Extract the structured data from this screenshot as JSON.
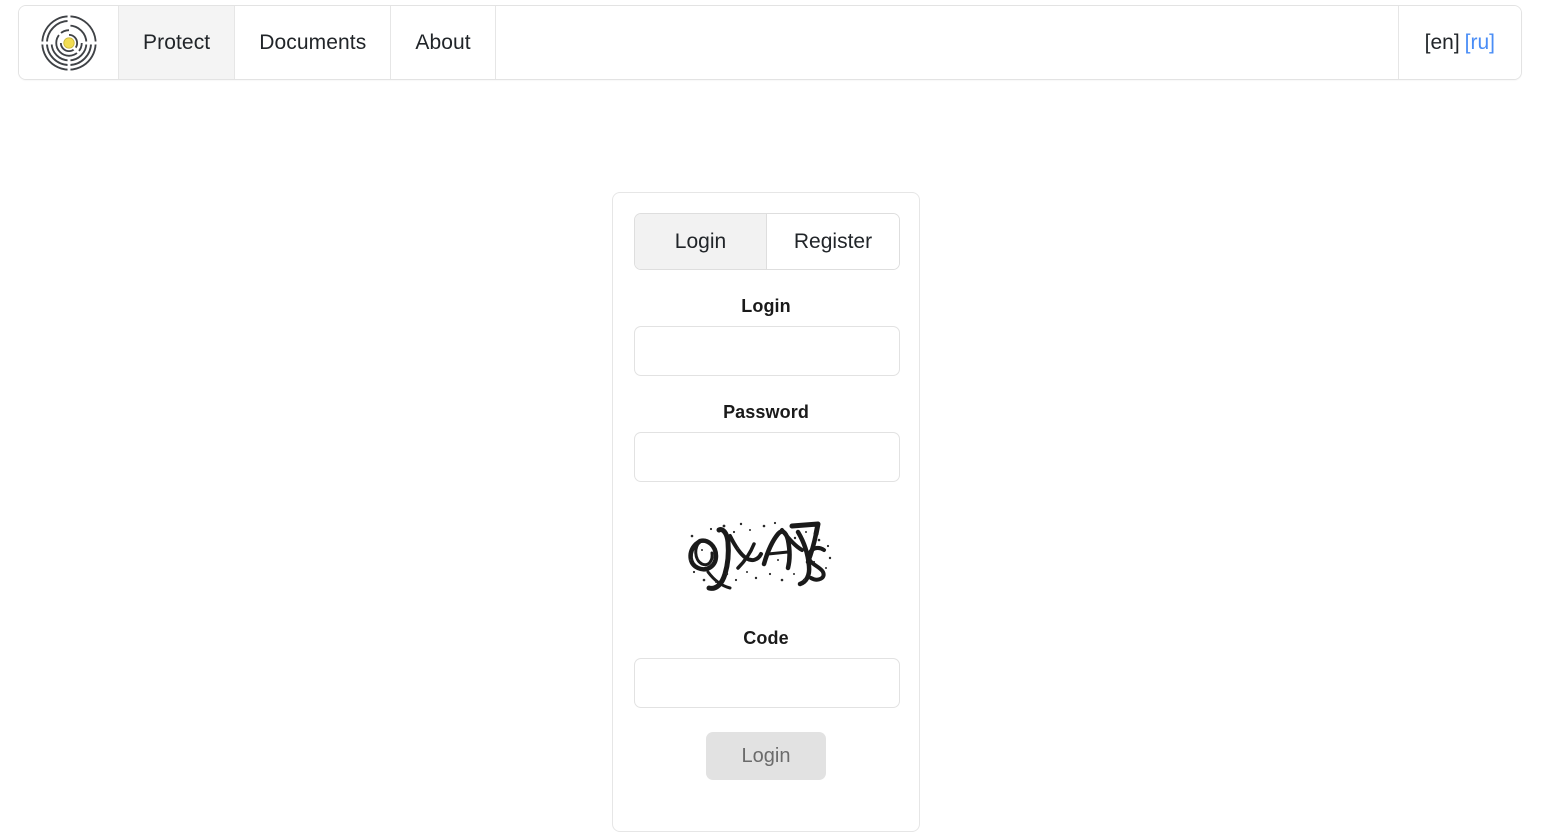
{
  "navbar": {
    "brand": {
      "icon": "labyrinth-logo-icon",
      "ring_color": "#3f4246",
      "center_color": "#f2dd52"
    },
    "items": [
      {
        "label": "Protect",
        "active": true
      },
      {
        "label": "Documents",
        "active": false
      },
      {
        "label": "About",
        "active": false
      }
    ],
    "language": {
      "current": "[en]",
      "alternate": "[ru]",
      "link_color": "#4a8df6"
    }
  },
  "auth_card": {
    "tabs": [
      {
        "label": "Login",
        "active": true
      },
      {
        "label": "Register",
        "active": false
      }
    ],
    "fields": [
      {
        "label": "Login",
        "value": "",
        "placeholder": "",
        "type": "text"
      },
      {
        "label": "Password",
        "value": "",
        "placeholder": "",
        "type": "password"
      }
    ],
    "captcha": {
      "alt": "captcha-image",
      "description": "distorted handwritten security code image"
    },
    "code_field": {
      "label": "Code",
      "value": "",
      "placeholder": "",
      "type": "text"
    },
    "submit": {
      "label": "Login",
      "background": "#e2e2e2",
      "text_color": "#6b6b6b"
    }
  }
}
